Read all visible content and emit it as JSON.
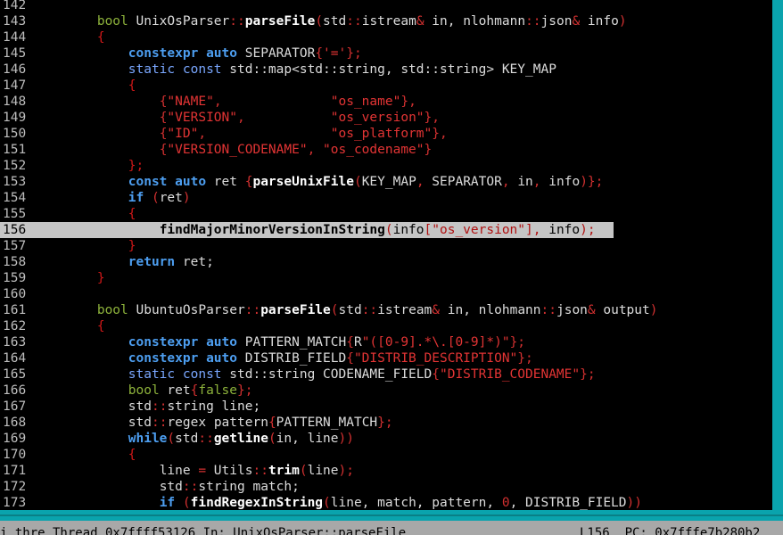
{
  "editor": {
    "lines": [
      {
        "num": "142",
        "tokens": []
      },
      {
        "num": "143",
        "tokens": [
          [
            "",
            "        "
          ],
          [
            "ty",
            "bool"
          ],
          [
            "p",
            " UnixOsParser"
          ],
          [
            "op",
            "::"
          ],
          [
            "fn",
            "parseFile"
          ],
          [
            "op",
            "("
          ],
          [
            "p",
            "std"
          ],
          [
            "op",
            "::"
          ],
          [
            "p",
            "istream"
          ],
          [
            "op",
            "&"
          ],
          [
            "p",
            " in, nlohmann"
          ],
          [
            "op",
            "::"
          ],
          [
            "p",
            "json"
          ],
          [
            "op",
            "&"
          ],
          [
            "p",
            " info"
          ],
          [
            "op",
            ")"
          ]
        ]
      },
      {
        "num": "144",
        "tokens": [
          [
            "",
            "        "
          ],
          [
            "br",
            "{"
          ]
        ]
      },
      {
        "num": "145",
        "tokens": [
          [
            "",
            "            "
          ],
          [
            "kw",
            "constexpr"
          ],
          [
            "p",
            " "
          ],
          [
            "kw",
            "auto"
          ],
          [
            "p",
            " SEPARATOR"
          ],
          [
            "op",
            "{"
          ],
          [
            "s",
            "'='"
          ],
          [
            "op",
            "};"
          ]
        ]
      },
      {
        "num": "146",
        "tokens": [
          [
            "",
            "            "
          ],
          [
            "k",
            "static"
          ],
          [
            "p",
            " "
          ],
          [
            "k",
            "const"
          ],
          [
            "p",
            " std::map<std::string, std::string> KEY_MAP"
          ]
        ]
      },
      {
        "num": "147",
        "tokens": [
          [
            "",
            "            "
          ],
          [
            "br",
            "{"
          ]
        ]
      },
      {
        "num": "148",
        "tokens": [
          [
            "",
            "                "
          ],
          [
            "op",
            "{"
          ],
          [
            "s",
            "\"NAME\""
          ],
          [
            "op",
            ",              "
          ],
          [
            "s",
            "\"os_name\""
          ],
          [
            "op",
            "},"
          ]
        ]
      },
      {
        "num": "149",
        "tokens": [
          [
            "",
            "                "
          ],
          [
            "op",
            "{"
          ],
          [
            "s",
            "\"VERSION\""
          ],
          [
            "op",
            ",           "
          ],
          [
            "s",
            "\"os_version\""
          ],
          [
            "op",
            "},"
          ]
        ]
      },
      {
        "num": "150",
        "tokens": [
          [
            "",
            "                "
          ],
          [
            "op",
            "{"
          ],
          [
            "s",
            "\"ID\""
          ],
          [
            "op",
            ",                "
          ],
          [
            "s",
            "\"os_platform\""
          ],
          [
            "op",
            "},"
          ]
        ]
      },
      {
        "num": "151",
        "tokens": [
          [
            "",
            "                "
          ],
          [
            "op",
            "{"
          ],
          [
            "s",
            "\"VERSION_CODENAME\""
          ],
          [
            "op",
            ", "
          ],
          [
            "s",
            "\"os_codename\""
          ],
          [
            "op",
            "}"
          ]
        ]
      },
      {
        "num": "152",
        "tokens": [
          [
            "",
            "            "
          ],
          [
            "br",
            "};"
          ]
        ]
      },
      {
        "num": "153",
        "tokens": [
          [
            "",
            "            "
          ],
          [
            "kw",
            "const"
          ],
          [
            "p",
            " "
          ],
          [
            "kw",
            "auto"
          ],
          [
            "p",
            " ret "
          ],
          [
            "op",
            "{"
          ],
          [
            "fn",
            "parseUnixFile"
          ],
          [
            "op",
            "("
          ],
          [
            "p",
            "KEY_MAP"
          ],
          [
            "op",
            ","
          ],
          [
            "p",
            " SEPARATOR"
          ],
          [
            "op",
            ","
          ],
          [
            "p",
            " in"
          ],
          [
            "op",
            ","
          ],
          [
            "p",
            " info"
          ],
          [
            "op",
            ")};"
          ]
        ]
      },
      {
        "num": "154",
        "tokens": [
          [
            "",
            "            "
          ],
          [
            "kw",
            "if"
          ],
          [
            "p",
            " "
          ],
          [
            "op",
            "("
          ],
          [
            "p",
            "ret"
          ],
          [
            "op",
            ")"
          ]
        ]
      },
      {
        "num": "155",
        "tokens": [
          [
            "",
            "            "
          ],
          [
            "br",
            "{"
          ]
        ]
      },
      {
        "num": "156",
        "highlight": true,
        "tokens": [
          [
            "",
            "                "
          ],
          [
            "fn",
            "findMajorMinorVersionInString"
          ],
          [
            "op",
            "("
          ],
          [
            "p",
            "info"
          ],
          [
            "op",
            "["
          ],
          [
            "s",
            "\"os_version\""
          ],
          [
            "op",
            "],"
          ],
          [
            "p",
            " info"
          ],
          [
            "op",
            ");"
          ]
        ]
      },
      {
        "num": "157",
        "tokens": [
          [
            "",
            "            "
          ],
          [
            "br",
            "}"
          ]
        ]
      },
      {
        "num": "158",
        "tokens": [
          [
            "",
            "            "
          ],
          [
            "kw",
            "return"
          ],
          [
            "p",
            " ret;"
          ]
        ]
      },
      {
        "num": "159",
        "tokens": [
          [
            "",
            "        "
          ],
          [
            "br",
            "}"
          ]
        ]
      },
      {
        "num": "160",
        "tokens": []
      },
      {
        "num": "161",
        "tokens": [
          [
            "",
            "        "
          ],
          [
            "ty",
            "bool"
          ],
          [
            "p",
            " UbuntuOsParser"
          ],
          [
            "op",
            "::"
          ],
          [
            "fn",
            "parseFile"
          ],
          [
            "op",
            "("
          ],
          [
            "p",
            "std"
          ],
          [
            "op",
            "::"
          ],
          [
            "p",
            "istream"
          ],
          [
            "op",
            "&"
          ],
          [
            "p",
            " in, nlohmann"
          ],
          [
            "op",
            "::"
          ],
          [
            "p",
            "json"
          ],
          [
            "op",
            "&"
          ],
          [
            "p",
            " output"
          ],
          [
            "op",
            ")"
          ]
        ]
      },
      {
        "num": "162",
        "tokens": [
          [
            "",
            "        "
          ],
          [
            "br",
            "{"
          ]
        ]
      },
      {
        "num": "163",
        "tokens": [
          [
            "",
            "            "
          ],
          [
            "kw",
            "constexpr"
          ],
          [
            "p",
            " "
          ],
          [
            "kw",
            "auto"
          ],
          [
            "p",
            " PATTERN_MATCH"
          ],
          [
            "op",
            "{"
          ],
          [
            "p",
            "R"
          ],
          [
            "s",
            "\"([0-9].*\\.[0-9]*)\""
          ],
          [
            "op",
            "};"
          ]
        ]
      },
      {
        "num": "164",
        "tokens": [
          [
            "",
            "            "
          ],
          [
            "kw",
            "constexpr"
          ],
          [
            "p",
            " "
          ],
          [
            "kw",
            "auto"
          ],
          [
            "p",
            " DISTRIB_FIELD"
          ],
          [
            "op",
            "{"
          ],
          [
            "s",
            "\"DISTRIB_DESCRIPTION\""
          ],
          [
            "op",
            "};"
          ]
        ]
      },
      {
        "num": "165",
        "tokens": [
          [
            "",
            "            "
          ],
          [
            "k",
            "static"
          ],
          [
            "p",
            " "
          ],
          [
            "k",
            "const"
          ],
          [
            "p",
            " std::string CODENAME_FIELD"
          ],
          [
            "op",
            "{"
          ],
          [
            "s",
            "\"DISTRIB_CODENAME\""
          ],
          [
            "op",
            "};"
          ]
        ]
      },
      {
        "num": "166",
        "tokens": [
          [
            "",
            "            "
          ],
          [
            "ty",
            "bool"
          ],
          [
            "p",
            " ret"
          ],
          [
            "op",
            "{"
          ],
          [
            "ty",
            "false"
          ],
          [
            "op",
            "};"
          ]
        ]
      },
      {
        "num": "167",
        "tokens": [
          [
            "",
            "            "
          ],
          [
            "p",
            "std"
          ],
          [
            "op",
            "::"
          ],
          [
            "p",
            "string line;"
          ]
        ]
      },
      {
        "num": "168",
        "tokens": [
          [
            "",
            "            "
          ],
          [
            "p",
            "std"
          ],
          [
            "op",
            "::"
          ],
          [
            "p",
            "regex pattern"
          ],
          [
            "op",
            "{"
          ],
          [
            "p",
            "PATTERN_MATCH"
          ],
          [
            "op",
            "};"
          ]
        ]
      },
      {
        "num": "169",
        "tokens": [
          [
            "",
            "            "
          ],
          [
            "kw",
            "while"
          ],
          [
            "op",
            "("
          ],
          [
            "p",
            "std"
          ],
          [
            "op",
            "::"
          ],
          [
            "fn",
            "getline"
          ],
          [
            "op",
            "("
          ],
          [
            "p",
            "in, line"
          ],
          [
            "op",
            "))"
          ]
        ]
      },
      {
        "num": "170",
        "tokens": [
          [
            "",
            "            "
          ],
          [
            "br",
            "{"
          ]
        ]
      },
      {
        "num": "171",
        "tokens": [
          [
            "",
            "                "
          ],
          [
            "p",
            "line "
          ],
          [
            "op",
            "="
          ],
          [
            "p",
            " Utils"
          ],
          [
            "op",
            "::"
          ],
          [
            "fn",
            "trim"
          ],
          [
            "op",
            "("
          ],
          [
            "p",
            "line"
          ],
          [
            "op",
            ");"
          ]
        ]
      },
      {
        "num": "172",
        "tokens": [
          [
            "",
            "                "
          ],
          [
            "p",
            "std"
          ],
          [
            "op",
            "::"
          ],
          [
            "p",
            "string match;"
          ]
        ]
      },
      {
        "num": "173",
        "tokens": [
          [
            "",
            "                "
          ],
          [
            "kw",
            "if"
          ],
          [
            "p",
            " "
          ],
          [
            "op",
            "("
          ],
          [
            "fn",
            "findRegexInString"
          ],
          [
            "op",
            "("
          ],
          [
            "p",
            "line, match, pattern, "
          ],
          [
            "n",
            "0"
          ],
          [
            "p",
            ", DISTRIB_FIELD"
          ],
          [
            "op",
            "))"
          ]
        ]
      }
    ]
  },
  "statusbar": {
    "left": "i thre Thread 0x7ffff53126 In: UnixOsParser::parseFile",
    "right": "L156  PC: 0x7fffe7b280b2"
  }
}
